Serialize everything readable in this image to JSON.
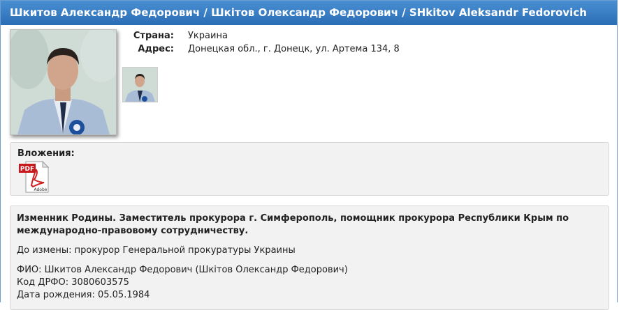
{
  "header": {
    "title": "Шкитов Александр Федорович / Шкітов Олександр Федорович / SHkitov Aleksandr Fedorovich"
  },
  "info": {
    "country_label": "Страна:",
    "country_value": "Украина",
    "address_label": "Адрес:",
    "address_value": "Донецкая обл., г. Донецк, ул. Артема 134, 8"
  },
  "attachments": {
    "title": "Вложения:",
    "file_type": "PDF",
    "file_brand": "Adobe"
  },
  "description": {
    "title": "Изменник Родины. Заместитель прокурора г. Симферополь, помощник прокурора Республики Крым по международно-правовому сотрудничеству.",
    "before_change": "До измены: прокурор Генеральной прокуратуры Украины",
    "fio": "ФИО: Шкитов Александр Федорович (Шкітов Олександр Федорович)",
    "drfo": "Код ДРФО: 3080603575",
    "birth_date": "Дата рождения: 05.05.1984"
  },
  "colors": {
    "header_bg": "#3b7fc4",
    "panel_bg": "#f2f2f2"
  }
}
